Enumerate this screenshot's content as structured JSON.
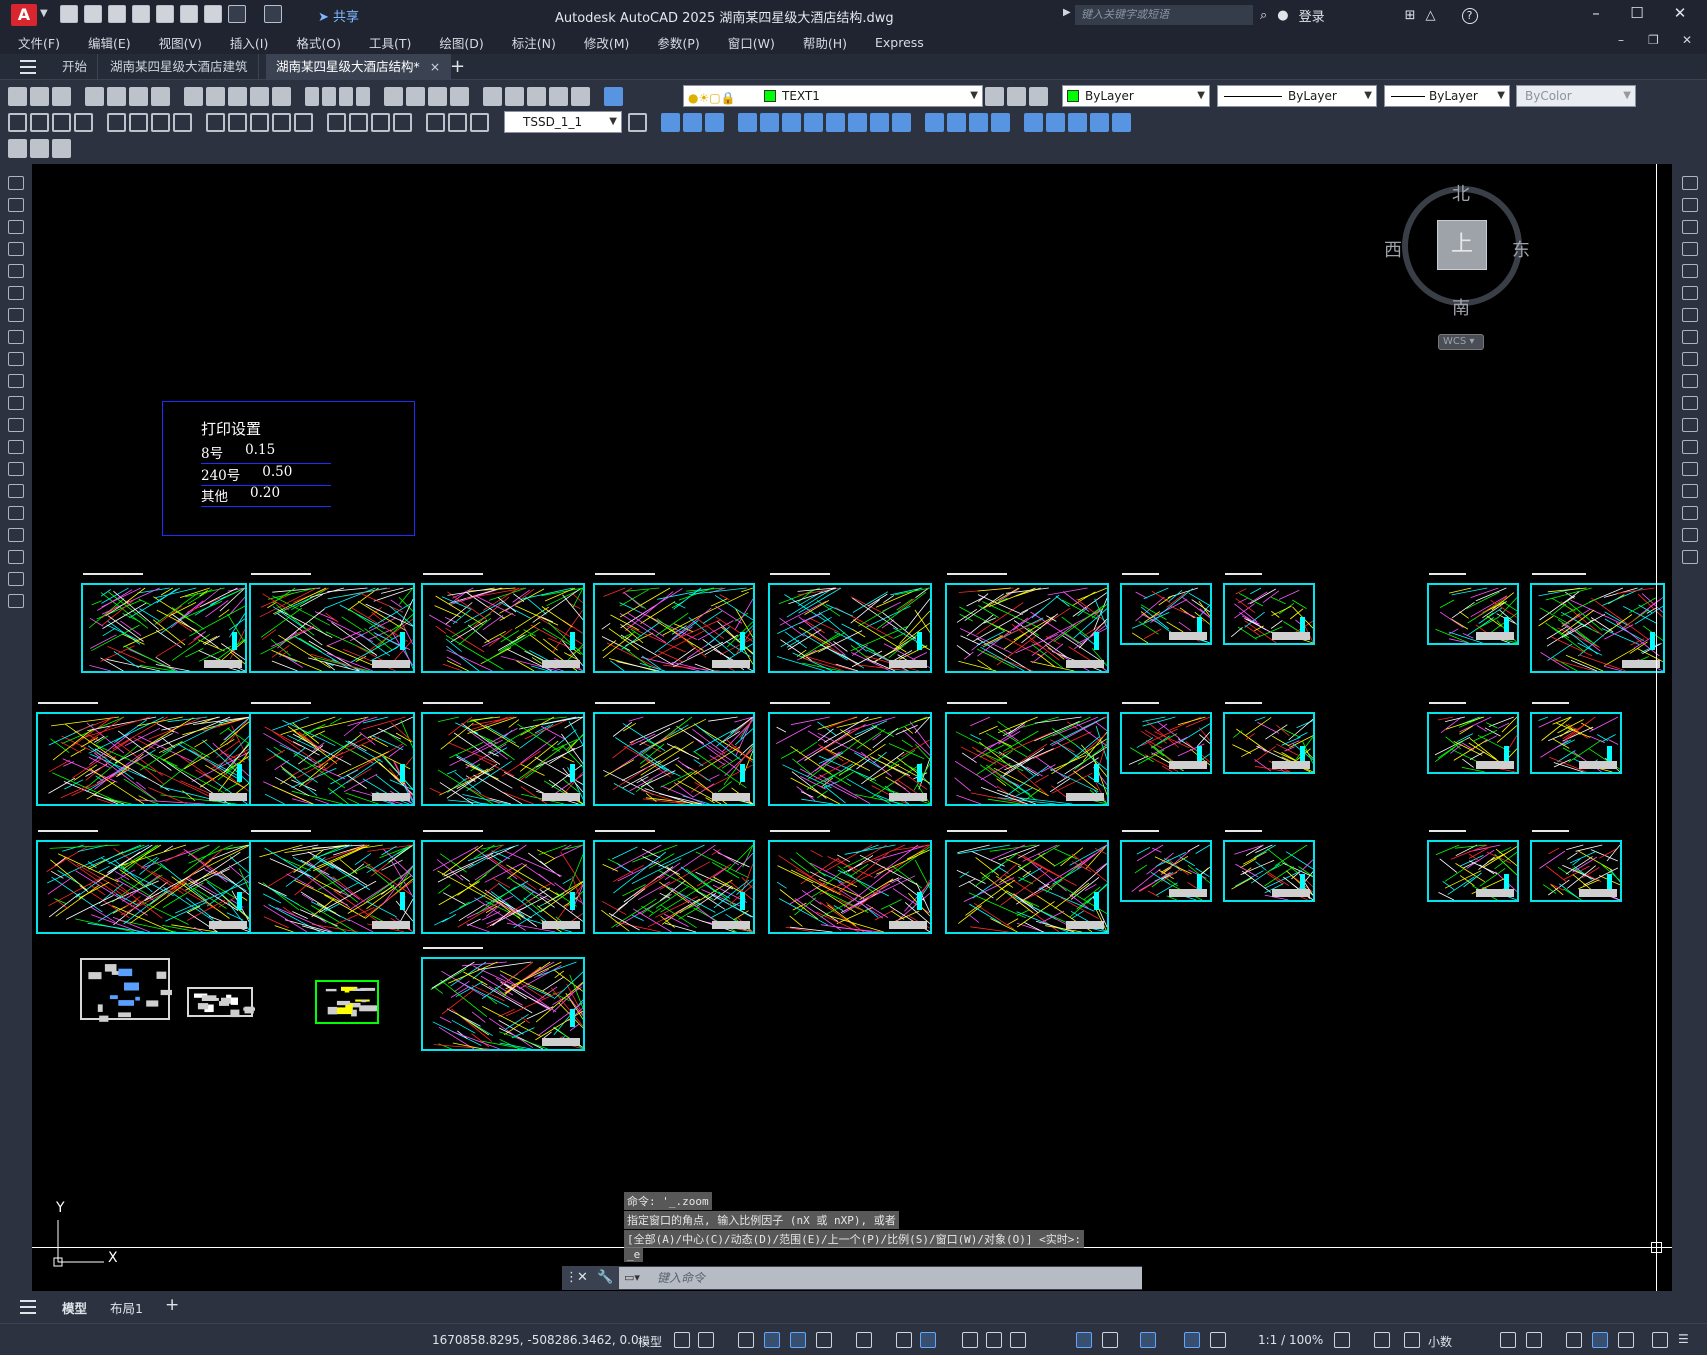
{
  "titlebar": {
    "app_logo": "A",
    "share_label": "共享",
    "title": "Autodesk AutoCAD 2025    湖南某四星级大酒店结构.dwg",
    "search_placeholder": "键入关键字或短语",
    "login_label": "登录",
    "help_label": "?"
  },
  "menu": [
    "文件(F)",
    "编辑(E)",
    "视图(V)",
    "插入(I)",
    "格式(O)",
    "工具(T)",
    "绘图(D)",
    "标注(N)",
    "修改(M)",
    "参数(P)",
    "窗口(W)",
    "帮助(H)",
    "Express"
  ],
  "tabs": {
    "items": [
      "开始",
      "湖南某四星级大酒店建筑",
      "湖南某四星级大酒店结构*"
    ],
    "active_index": 2,
    "close_glyph": "×",
    "add_glyph": "+"
  },
  "properties": {
    "layer": "TEXT1",
    "color": "ByLayer",
    "color_swatch": "#00ff00",
    "linetype": "ByLayer",
    "lineweight": "ByLayer",
    "plotstyle": "ByColor",
    "textstyle": "TSSD_1_1"
  },
  "print_settings": {
    "title": "打印设置",
    "rows": [
      {
        "label": "8号",
        "value": "0.15"
      },
      {
        "label": "240号",
        "value": "0.50"
      },
      {
        "label": "其他",
        "value": "0.20"
      }
    ]
  },
  "viewcube": {
    "north": "北",
    "south": "南",
    "east": "东",
    "west": "西",
    "face": "上",
    "wcs_label": "WCS"
  },
  "ucs": {
    "x": "X",
    "y": "Y"
  },
  "command": {
    "history": [
      "命令: '_.zoom",
      "指定窗口的角点, 输入比例因子 (nX 或 nXP), 或者",
      "[全部(A)/中心(C)/动态(D)/范围(E)/上一个(P)/比例(S)/窗口(W)/对象(O)] <实时>:",
      "_e"
    ],
    "placeholder": "键入命令"
  },
  "layout_tabs": {
    "model": "模型",
    "layout1": "布局1",
    "add": "+"
  },
  "status": {
    "coords": "1670858.8295, -508286.3462, 0.0...",
    "model_label": "模型",
    "scale": "1:1 / 100%",
    "units": "小数"
  },
  "colors": {
    "sheet_frame": "#00e5ee",
    "print_box": "#1f2cff",
    "accent": "#5fa7ff"
  }
}
